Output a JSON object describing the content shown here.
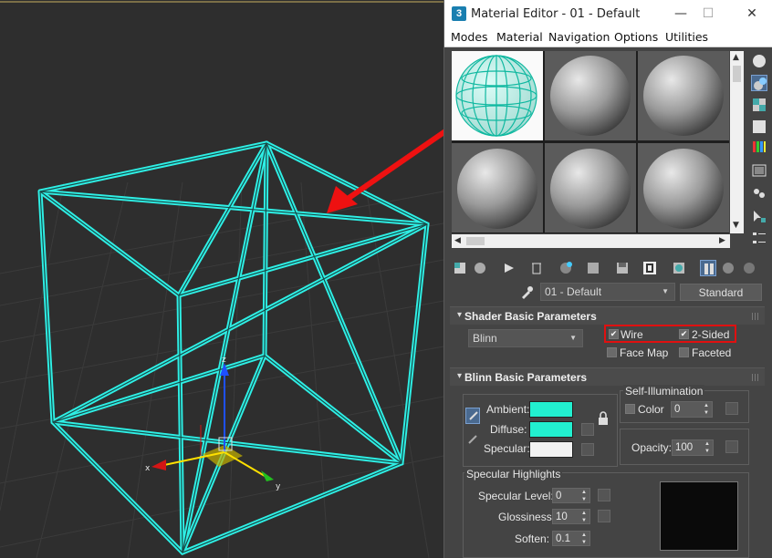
{
  "window": {
    "app_icon": "3",
    "title": "Material Editor - 01 - Default",
    "minimize": "—",
    "maximize": "☐",
    "close": "✕"
  },
  "menu": [
    "Modes",
    "Material",
    "Navigation",
    "Options",
    "Utilities"
  ],
  "viewport": {
    "axis_x": "x",
    "axis_y": "y",
    "axis_z": "z"
  },
  "material": {
    "name": "01 - Default",
    "type_button": "Standard"
  },
  "shader_basic": {
    "header": "Shader Basic Parameters",
    "shader": "Blinn",
    "wire": "Wire",
    "two_sided": "2-Sided",
    "face_map": "Face Map",
    "faceted": "Faceted"
  },
  "blinn_basic": {
    "header": "Blinn Basic Parameters",
    "ambient": "Ambient:",
    "diffuse": "Diffuse:",
    "specular": "Specular:",
    "self_illum": "Self-Illumination",
    "color": "Color",
    "color_value": "0",
    "opacity": "Opacity:",
    "opacity_value": "100",
    "ambient_color": "#22f0d0",
    "diffuse_color": "#22f0d0",
    "specular_color": "#f2f2f2"
  },
  "specular_highlights": {
    "header": "Specular Highlights",
    "level": "Specular Level:",
    "level_value": "0",
    "glossiness": "Glossiness:",
    "glossiness_value": "10",
    "soften": "Soften:",
    "soften_value": "0.1"
  },
  "colors": {
    "wire": "#2ef0e6",
    "arrow": "#ee1111",
    "highlight_box": "#e01010"
  }
}
